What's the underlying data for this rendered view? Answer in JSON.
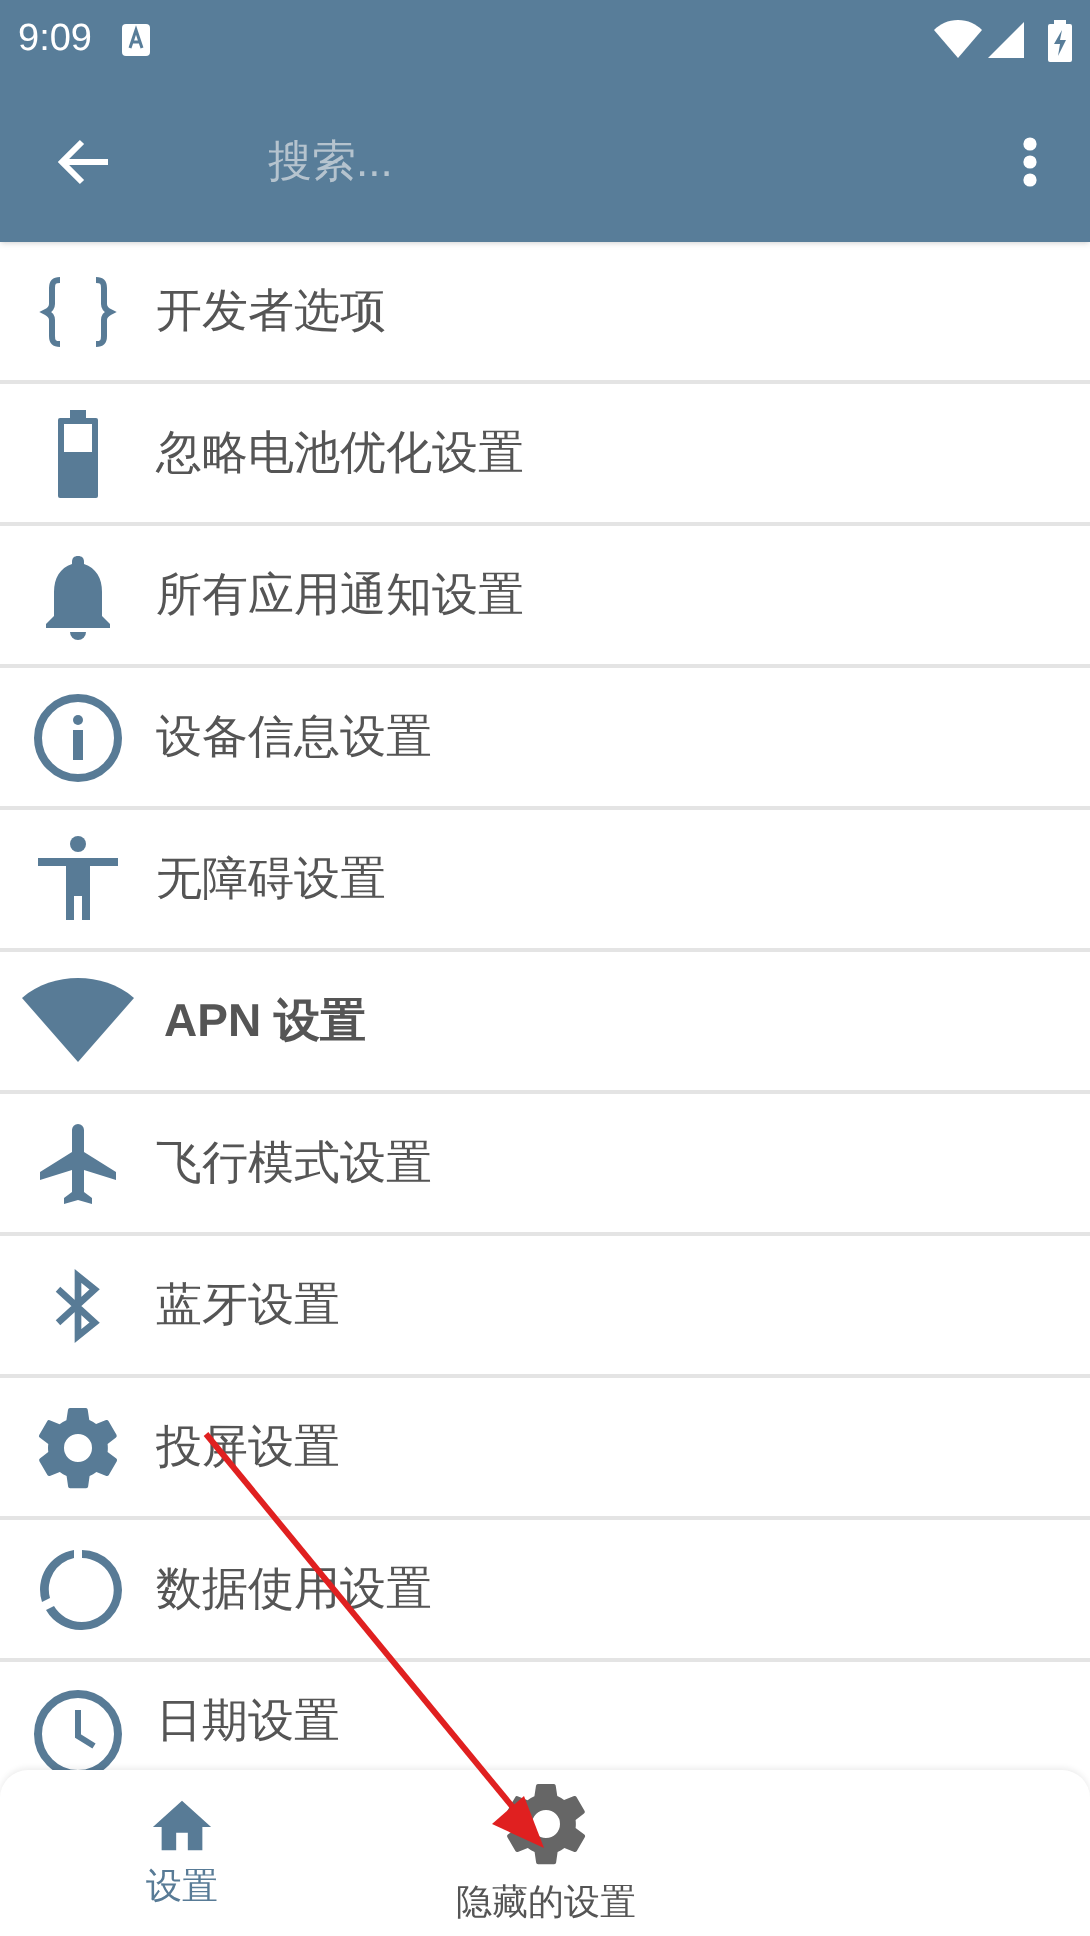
{
  "status_bar": {
    "time": "9:09"
  },
  "toolbar": {
    "search": {
      "placeholder": "搜索..."
    }
  },
  "items": [
    {
      "kind": "braces",
      "label": "开发者选项"
    },
    {
      "kind": "battery",
      "label": "忽略电池优化设置"
    },
    {
      "kind": "bell",
      "label": "所有应用通知设置"
    },
    {
      "kind": "info",
      "label": "设备信息设置"
    },
    {
      "kind": "accessibility",
      "label": "无障碍设置"
    },
    {
      "kind": "wifi",
      "label": "APN 设置"
    },
    {
      "kind": "airplane",
      "label": "飞行模式设置"
    },
    {
      "kind": "bluetooth",
      "label": "蓝牙设置"
    },
    {
      "kind": "gear",
      "label": "投屏设置"
    },
    {
      "kind": "data",
      "label": "数据使用设置"
    },
    {
      "kind": "clock",
      "label": "日期设置"
    }
  ],
  "bottom_nav": [
    {
      "kind": "home",
      "label": "设置",
      "selected": true
    },
    {
      "kind": "gear",
      "label": "隐藏的设置",
      "selected": false
    }
  ]
}
